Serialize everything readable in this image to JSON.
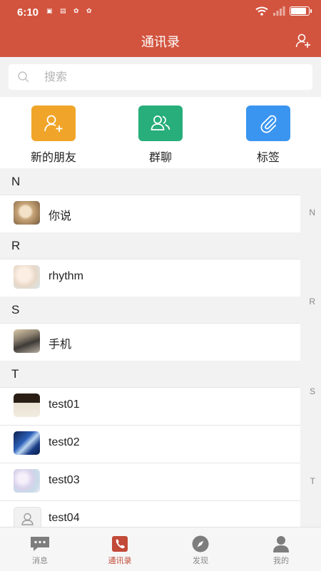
{
  "status": {
    "time": "6:10",
    "app_icons": "▣ ▤ ✿ ✿"
  },
  "header": {
    "title": "通讯录"
  },
  "search": {
    "placeholder": "搜索",
    "value": ""
  },
  "quick_actions": [
    {
      "label": "新的朋友",
      "color": "#f0a52a",
      "icon": "add-user-icon"
    },
    {
      "label": "群聊",
      "color": "#27ae7a",
      "icon": "group-icon"
    },
    {
      "label": "标签",
      "color": "#3a95f0",
      "icon": "paperclip-icon"
    }
  ],
  "sections": [
    {
      "letter": "N",
      "contacts": [
        {
          "name": "你说"
        }
      ]
    },
    {
      "letter": "R",
      "contacts": [
        {
          "name": "rhythm"
        }
      ]
    },
    {
      "letter": "S",
      "contacts": [
        {
          "name": "手机"
        }
      ]
    },
    {
      "letter": "T",
      "contacts": [
        {
          "name": "test01"
        },
        {
          "name": "test02"
        },
        {
          "name": "test03"
        },
        {
          "name": "test04"
        }
      ]
    }
  ],
  "index_letters": [
    "N",
    "R",
    "S",
    "T"
  ],
  "tabs": [
    {
      "label": "消息",
      "icon": "chat-icon"
    },
    {
      "label": "通讯录",
      "icon": "contacts-book-icon",
      "active": true
    },
    {
      "label": "发现",
      "icon": "compass-icon"
    },
    {
      "label": "我的",
      "icon": "person-icon"
    }
  ],
  "colors": {
    "header": "#d2543f",
    "active_tab": "#c24a38",
    "background": "#f2f2f2"
  }
}
